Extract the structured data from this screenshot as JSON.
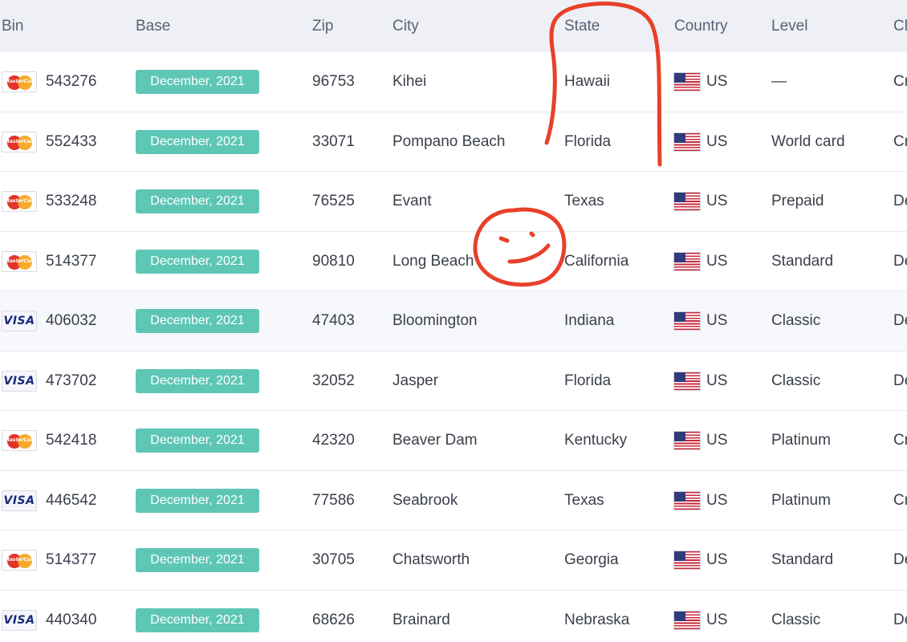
{
  "header": {
    "bin": "Bin",
    "base": "Base",
    "zip": "Zip",
    "city": "City",
    "state": "State",
    "country": "Country",
    "level": "Level",
    "cl": "Cl"
  },
  "rows": [
    {
      "card": "mastercard",
      "bin": "543276",
      "base": "December, 2021",
      "zip": "96753",
      "city": "Kihei",
      "state": "Hawaii",
      "country": "US",
      "level": "—",
      "cl": "Cr"
    },
    {
      "card": "mastercard",
      "bin": "552433",
      "base": "December, 2021",
      "zip": "33071",
      "city": "Pompano Beach",
      "state": "Florida",
      "country": "US",
      "level": "World card",
      "cl": "Cr"
    },
    {
      "card": "mastercard",
      "bin": "533248",
      "base": "December, 2021",
      "zip": "76525",
      "city": "Evant",
      "state": "Texas",
      "country": "US",
      "level": "Prepaid",
      "cl": "De"
    },
    {
      "card": "mastercard",
      "bin": "514377",
      "base": "December, 2021",
      "zip": "90810",
      "city": "Long Beach",
      "state": "California",
      "country": "US",
      "level": "Standard",
      "cl": "De"
    },
    {
      "card": "visa",
      "bin": "406032",
      "base": "December, 2021",
      "zip": "47403",
      "city": "Bloomington",
      "state": "Indiana",
      "country": "US",
      "level": "Classic",
      "cl": "De"
    },
    {
      "card": "visa",
      "bin": "473702",
      "base": "December, 2021",
      "zip": "32052",
      "city": "Jasper",
      "state": "Florida",
      "country": "US",
      "level": "Classic",
      "cl": "De"
    },
    {
      "card": "mastercard",
      "bin": "542418",
      "base": "December, 2021",
      "zip": "42320",
      "city": "Beaver Dam",
      "state": "Kentucky",
      "country": "US",
      "level": "Platinum",
      "cl": "Cr"
    },
    {
      "card": "visa",
      "bin": "446542",
      "base": "December, 2021",
      "zip": "77586",
      "city": "Seabrook",
      "state": "Texas",
      "country": "US",
      "level": "Platinum",
      "cl": "Cr"
    },
    {
      "card": "mastercard",
      "bin": "514377",
      "base": "December, 2021",
      "zip": "30705",
      "city": "Chatsworth",
      "state": "Georgia",
      "country": "US",
      "level": "Standard",
      "cl": "De"
    },
    {
      "card": "visa",
      "bin": "440340",
      "base": "December, 2021",
      "zip": "68626",
      "city": "Brainard",
      "state": "Nebraska",
      "country": "US",
      "level": "Classic",
      "cl": "De"
    }
  ],
  "card_logos": {
    "mastercard": "MasterCard",
    "visa": "VISA"
  },
  "colors": {
    "badge": "#5ec6b5",
    "header_bg": "#eef0f5",
    "annotation": "#e8402a"
  }
}
